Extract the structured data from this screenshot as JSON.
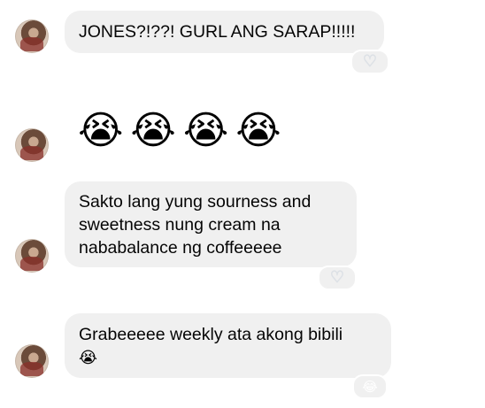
{
  "messages": [
    {
      "text": "JONES?!??! GURL ANG SARAP!!!!!",
      "reaction": "♡"
    },
    {
      "emojis": [
        "😭",
        "😭",
        "😭",
        "😭"
      ]
    },
    {
      "text": "Sakto lang yung sourness and sweetness nung cream na nababalance ng coffeeeee",
      "reaction": "♡"
    },
    {
      "text": "Grabeeeee weekly ata akong bibili",
      "emoji": "😭",
      "reaction": "😂"
    }
  ],
  "icons": {
    "avatar": "contact-avatar-icon",
    "heart": "heart-reaction-icon",
    "laugh": "laugh-reaction-icon"
  }
}
